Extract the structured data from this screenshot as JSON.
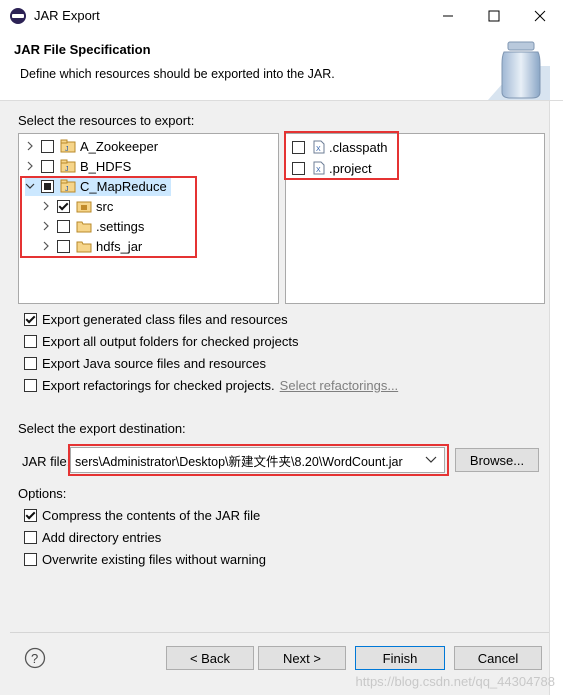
{
  "window": {
    "title": "JAR Export"
  },
  "header": {
    "title": "JAR File Specification",
    "description": "Define which resources should be exported into the JAR."
  },
  "resources": {
    "label": "Select the resources to export:",
    "tree": [
      {
        "label": "A_Zookeeper",
        "checked": false,
        "expanded": false,
        "icon": "project-icon"
      },
      {
        "label": "B_HDFS",
        "checked": false,
        "expanded": false,
        "icon": "project-icon"
      },
      {
        "label": "C_MapReduce",
        "checked": "partial",
        "expanded": true,
        "icon": "project-icon"
      },
      {
        "label": "src",
        "checked": true,
        "expanded": false,
        "icon": "package-folder-icon"
      },
      {
        "label": ".settings",
        "checked": false,
        "expanded": false,
        "icon": "folder-icon"
      },
      {
        "label": "hdfs_jar",
        "checked": false,
        "expanded": false,
        "icon": "folder-icon"
      }
    ],
    "files": [
      {
        "label": ".classpath",
        "checked": false,
        "icon": "xml-file-icon"
      },
      {
        "label": ".project",
        "checked": false,
        "icon": "xml-file-icon"
      }
    ]
  },
  "export_options": [
    {
      "label": "Export generated class files and resources",
      "checked": true
    },
    {
      "label": "Export all output folders for checked projects",
      "checked": false
    },
    {
      "label": "Export Java source files and resources",
      "checked": false
    },
    {
      "label": "Export refactorings for checked projects.",
      "checked": false
    }
  ],
  "select_refactorings_link": "Select refactorings...",
  "destination": {
    "label": "Select the export destination:",
    "jar_file_label": "JAR file:",
    "jar_file_value": "sers\\Administrator\\Desktop\\新建文件夹\\8.20\\WordCount.jar",
    "browse_label": "Browse..."
  },
  "options": {
    "label": "Options:",
    "items": [
      {
        "label": "Compress the contents of the JAR file",
        "checked": true
      },
      {
        "label": "Add directory entries",
        "checked": false
      },
      {
        "label": "Overwrite existing files without warning",
        "checked": false
      }
    ]
  },
  "buttons": {
    "back": "< Back",
    "next": "Next >",
    "finish": "Finish",
    "cancel": "Cancel"
  },
  "watermark": "https://blog.csdn.net/qq_44304788",
  "colors": {
    "highlight_red": "#e53333",
    "primary_border": "#0078d7"
  }
}
